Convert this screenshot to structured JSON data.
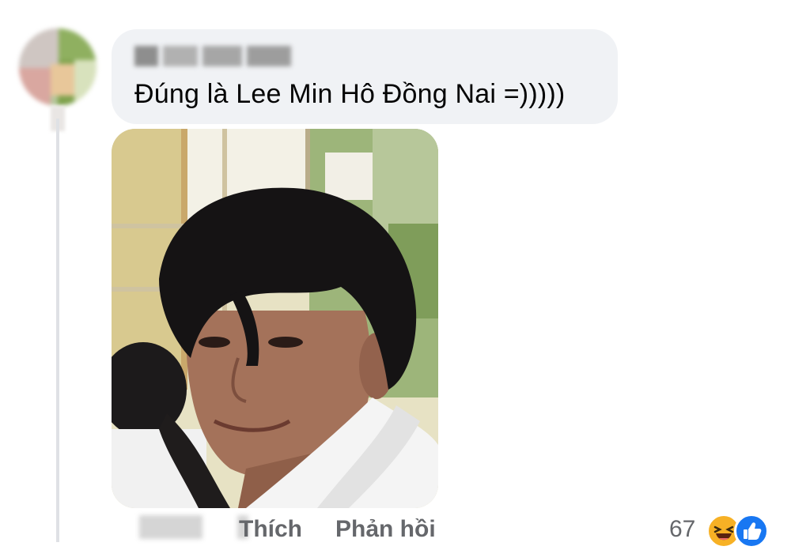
{
  "comment": {
    "text": "Đúng là Lee Min Hô Đồng Nai =)))))",
    "author": {
      "name_redacted": true
    }
  },
  "actions": {
    "like_label": "Thích",
    "reply_label": "Phản hồi"
  },
  "reactions": {
    "count": "67",
    "icons": [
      "laughing-face-icon",
      "thumbs-up-icon"
    ]
  },
  "colors": {
    "bubble": "#f0f2f5",
    "action_text": "#65676b",
    "comment_text": "#050505",
    "like_blue": "#1877f2",
    "haha_yellow": "#f7b125"
  }
}
